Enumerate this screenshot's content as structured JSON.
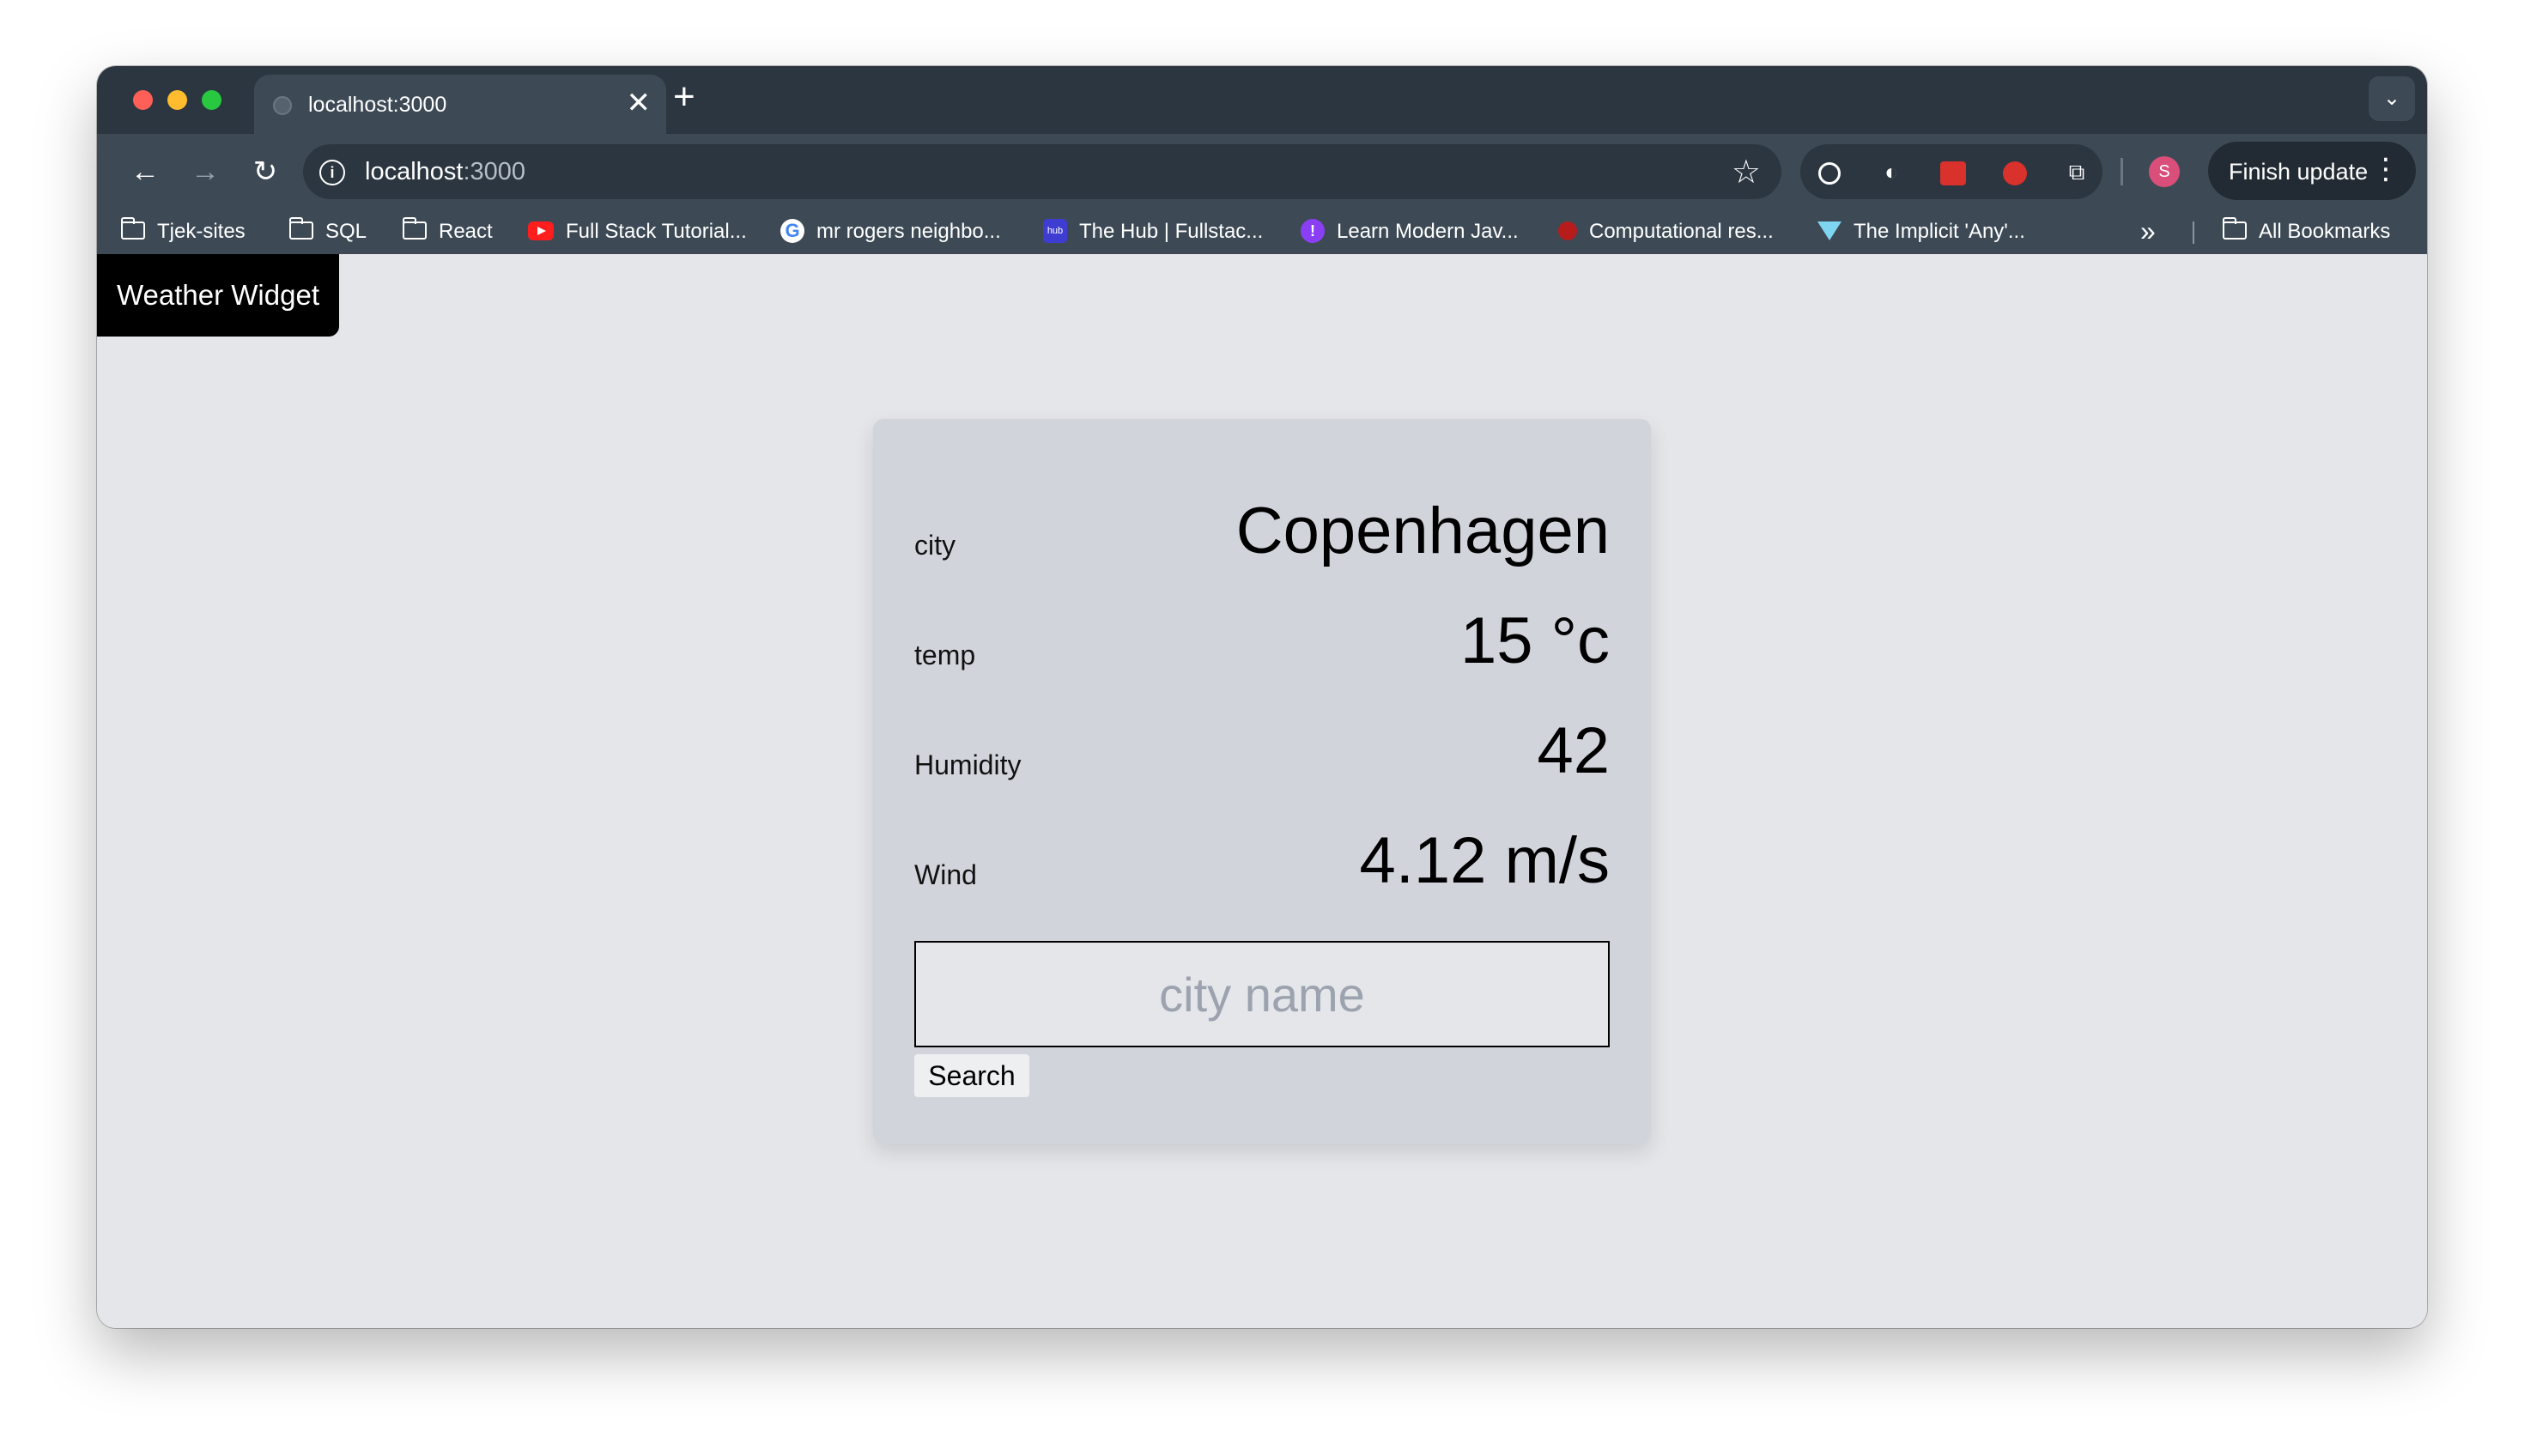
{
  "browser": {
    "tab": {
      "title": "localhost:3000",
      "close_glyph": "✕"
    },
    "new_tab_glyph": "+",
    "tab_search_glyph": "⌄",
    "nav": {
      "back_glyph": "←",
      "forward_glyph": "→",
      "reload_glyph": "↻"
    },
    "address": {
      "host": "localhost",
      "port": ":3000"
    },
    "star_glyph": "☆",
    "extensions": [
      "target-icon",
      "vpn-icon",
      "mendeley-icon",
      "hand-blocker-icon",
      "puzzle-icon"
    ],
    "profile_initial": "S",
    "finish_update_label": "Finish update",
    "menu_glyph": "⋮"
  },
  "bookmarks": {
    "items": [
      {
        "label": "Tjek-sites",
        "icon": "folder-icon"
      },
      {
        "label": "SQL",
        "icon": "folder-icon"
      },
      {
        "label": "React",
        "icon": "folder-icon"
      },
      {
        "label": "Full Stack Tutorial...",
        "icon": "youtube-icon"
      },
      {
        "label": "mr rogers neighbo...",
        "icon": "google-icon"
      },
      {
        "label": "The Hub | Fullstac...",
        "icon": "hub-icon"
      },
      {
        "label": "Learn Modern Jav...",
        "icon": "course-icon"
      },
      {
        "label": "Computational res...",
        "icon": "research-icon"
      },
      {
        "label": "The Implicit 'Any'...",
        "icon": "gem-icon"
      }
    ],
    "overflow_glyph": "»",
    "all_bookmarks_label": "All Bookmarks"
  },
  "app": {
    "title": "Weather Widget",
    "weather": {
      "city_label": "city",
      "city_value": "Copenhagen",
      "temp_label": "temp",
      "temp_value": "15 °c",
      "humidity_label": "Humidity",
      "humidity_value": "42",
      "wind_label": "Wind",
      "wind_value": "4.12 m/s"
    },
    "search": {
      "placeholder": "city name",
      "value": "",
      "button_label": "Search"
    }
  },
  "colors": {
    "tabstrip_bg": "#2b3640",
    "toolbar_bg": "#3d4a55",
    "page_bg": "#e4e6ea",
    "card_bg": "#d1d5db",
    "title_bg": "#000000"
  }
}
